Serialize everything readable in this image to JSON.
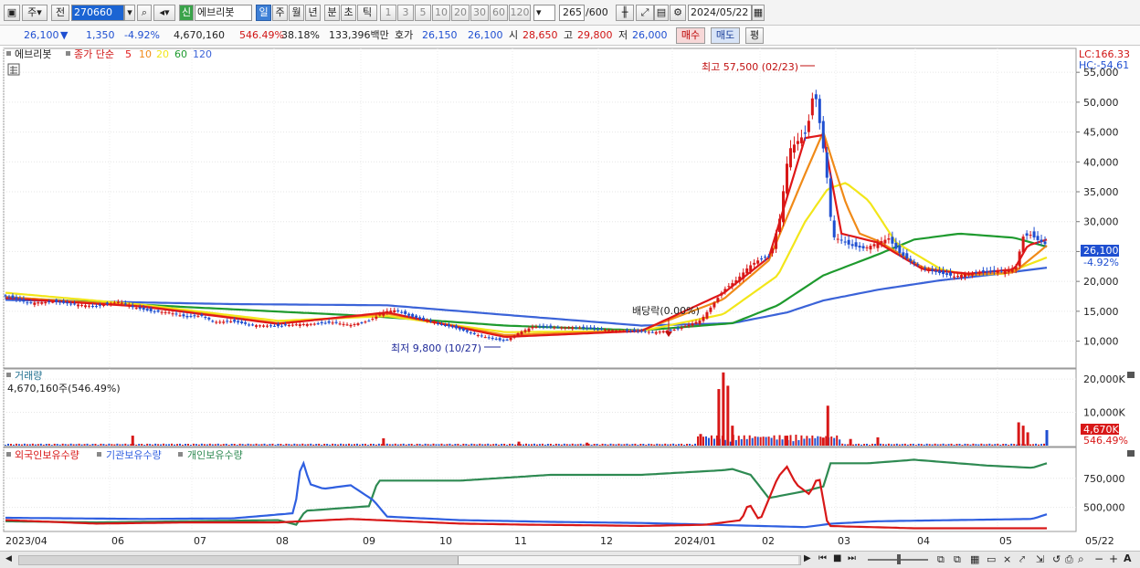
{
  "toolbar": {
    "mode": "주",
    "prev": "전",
    "code": "270660",
    "sin": "신",
    "name": "에브리봇",
    "periods": [
      "일",
      "주",
      "월",
      "년",
      "분",
      "초",
      "틱"
    ],
    "intervals": [
      "1",
      "3",
      "5",
      "10",
      "20",
      "30",
      "60",
      "120"
    ],
    "count": "265",
    "count_total": "/600",
    "date": "2024/05/22"
  },
  "quote": {
    "price": "26,100",
    "change": "1,350",
    "change_pct": "-4.92%",
    "volume": "4,670,160",
    "vol_ratio": "546.49%",
    "turnover": "38.18%",
    "amount": "133,396백만",
    "hoga_label": "호가",
    "ask": "26,150",
    "bid": "26,100",
    "open_label": "시",
    "open": "28,650",
    "high_label": "고",
    "high": "29,800",
    "low_label": "저",
    "low": "26,000",
    "buy": "매수",
    "sell": "매도",
    "pyeong": "평"
  },
  "price_panel": {
    "stock": "에브리봇",
    "legend_prefix": "종가 단순",
    "ma_periods": [
      "5",
      "10",
      "20",
      "60",
      "120"
    ],
    "ma_colors": [
      "#e01818",
      "#f08a18",
      "#f2e61a",
      "#1e9a2e",
      "#3b63d8"
    ],
    "lc": "LC:166.33",
    "hc": "HC:-54.61",
    "high_annotation": "최고 57,500 (02/23)",
    "low_annotation": "최저 9,800 (10/27)",
    "dividend_annotation": "배당락(0.00%)",
    "last_price": "26,100",
    "last_pct": "-4.92%"
  },
  "volume_panel": {
    "title": "거래량",
    "info": "4,670,160주(546.49%)",
    "last_label": "4,670K",
    "last_pct": "546.49%"
  },
  "holding_panel": {
    "legend": [
      "외국인보유수량",
      "기관보유수량",
      "개인보유수량"
    ],
    "colors": [
      "#d81818",
      "#2f5fe0",
      "#2e8a52"
    ]
  },
  "date_axis": [
    "2023/04",
    "06",
    "07",
    "08",
    "09",
    "10",
    "11",
    "12",
    "2024/01",
    "02",
    "03",
    "04",
    "05",
    "05/22"
  ],
  "chart_data": {
    "type": "candlestick",
    "price_axis": {
      "ticks": [
        10000,
        15000,
        20000,
        25000,
        30000,
        35000,
        40000,
        45000,
        50000,
        55000
      ],
      "labels": [
        "10,000",
        "15,000",
        "20,000",
        "25,000",
        "30,000",
        "35,000",
        "40,000",
        "45,000",
        "50,000",
        "55,000"
      ],
      "range": [
        5500,
        59000
      ]
    },
    "volume_axis": {
      "ticks": [
        10000,
        20000
      ],
      "labels": [
        "10,000K",
        "20,000K"
      ],
      "range": [
        0,
        22500
      ]
    },
    "holding_axis": {
      "ticks": [
        500000,
        750000
      ],
      "labels": [
        "500,000",
        "750,000"
      ],
      "range": [
        300000,
        1000000
      ]
    },
    "close_trend": [
      [
        0,
        17500
      ],
      [
        25,
        16400
      ],
      [
        50,
        16600
      ],
      [
        75,
        16200
      ],
      [
        100,
        15800
      ],
      [
        125,
        16600
      ],
      [
        140,
        15700
      ],
      [
        160,
        15000
      ],
      [
        180,
        14800
      ],
      [
        200,
        14000
      ],
      [
        215,
        14300
      ],
      [
        230,
        13200
      ],
      [
        250,
        13300
      ],
      [
        270,
        12700
      ],
      [
        300,
        12500
      ],
      [
        320,
        12800
      ],
      [
        340,
        12900
      ],
      [
        360,
        13100
      ],
      [
        380,
        12700
      ],
      [
        400,
        13400
      ],
      [
        418,
        15000
      ],
      [
        430,
        15200
      ],
      [
        445,
        14200
      ],
      [
        470,
        13200
      ],
      [
        495,
        12200
      ],
      [
        515,
        11200
      ],
      [
        535,
        10400
      ],
      [
        550,
        10000
      ],
      [
        565,
        11400
      ],
      [
        580,
        12400
      ],
      [
        600,
        12300
      ],
      [
        625,
        12300
      ],
      [
        650,
        12000
      ],
      [
        680,
        11700
      ],
      [
        715,
        11500
      ],
      [
        740,
        12000
      ],
      [
        765,
        13500
      ],
      [
        778,
        16000
      ],
      [
        790,
        18500
      ],
      [
        805,
        20300
      ],
      [
        818,
        22500
      ],
      [
        830,
        23700
      ],
      [
        842,
        24300
      ],
      [
        852,
        30500
      ],
      [
        862,
        42000
      ],
      [
        872,
        43500
      ],
      [
        882,
        45000
      ],
      [
        890,
        52500
      ],
      [
        897,
        45500
      ],
      [
        903,
        39000
      ],
      [
        910,
        27500
      ],
      [
        918,
        27000
      ],
      [
        930,
        26000
      ],
      [
        945,
        25500
      ],
      [
        960,
        26500
      ],
      [
        972,
        27200
      ],
      [
        982,
        25000
      ],
      [
        995,
        23500
      ],
      [
        1010,
        22200
      ],
      [
        1030,
        21300
      ],
      [
        1045,
        20800
      ],
      [
        1060,
        21400
      ],
      [
        1080,
        21500
      ],
      [
        1100,
        21700
      ],
      [
        1112,
        22500
      ],
      [
        1120,
        27500
      ],
      [
        1128,
        27800
      ],
      [
        1137,
        26800
      ],
      [
        1146,
        26100
      ]
    ],
    "moving_averages": {
      "5": [
        [
          0,
          17200
        ],
        [
          150,
          15800
        ],
        [
          300,
          12900
        ],
        [
          420,
          14800
        ],
        [
          550,
          10700
        ],
        [
          700,
          11700
        ],
        [
          790,
          18000
        ],
        [
          840,
          24000
        ],
        [
          880,
          44000
        ],
        [
          900,
          44500
        ],
        [
          920,
          28000
        ],
        [
          960,
          26500
        ],
        [
          1010,
          22000
        ],
        [
          1060,
          21300
        ],
        [
          1110,
          22000
        ],
        [
          1125,
          26000
        ],
        [
          1146,
          27000
        ]
      ],
      "10": [
        [
          0,
          17400
        ],
        [
          150,
          15900
        ],
        [
          300,
          13000
        ],
        [
          420,
          14600
        ],
        [
          550,
          11000
        ],
        [
          700,
          11800
        ],
        [
          790,
          17000
        ],
        [
          840,
          23500
        ],
        [
          880,
          38000
        ],
        [
          900,
          45000
        ],
        [
          925,
          33000
        ],
        [
          940,
          28000
        ],
        [
          960,
          26800
        ],
        [
          1010,
          22300
        ],
        [
          1060,
          21100
        ],
        [
          1110,
          21500
        ],
        [
          1146,
          26000
        ]
      ],
      "20": [
        [
          0,
          18100
        ],
        [
          150,
          16100
        ],
        [
          300,
          13400
        ],
        [
          420,
          14200
        ],
        [
          550,
          11500
        ],
        [
          700,
          11700
        ],
        [
          790,
          14500
        ],
        [
          850,
          21000
        ],
        [
          880,
          30000
        ],
        [
          905,
          35500
        ],
        [
          925,
          36500
        ],
        [
          950,
          33500
        ],
        [
          980,
          26500
        ],
        [
          1030,
          22000
        ],
        [
          1060,
          21100
        ],
        [
          1100,
          21300
        ],
        [
          1146,
          24000
        ]
      ],
      "60": [
        [
          0,
          17300
        ],
        [
          200,
          15700
        ],
        [
          400,
          14200
        ],
        [
          550,
          12600
        ],
        [
          700,
          11800
        ],
        [
          800,
          13000
        ],
        [
          850,
          16000
        ],
        [
          900,
          21000
        ],
        [
          960,
          24500
        ],
        [
          1000,
          27000
        ],
        [
          1050,
          28000
        ],
        [
          1110,
          27300
        ],
        [
          1146,
          25800
        ]
      ],
      "120": [
        [
          0,
          16900
        ],
        [
          250,
          16200
        ],
        [
          420,
          16000
        ],
        [
          550,
          14400
        ],
        [
          700,
          12600
        ],
        [
          800,
          13000
        ],
        [
          860,
          14800
        ],
        [
          900,
          16800
        ],
        [
          960,
          18600
        ],
        [
          1030,
          20200
        ],
        [
          1090,
          21200
        ],
        [
          1146,
          22300
        ]
      ]
    },
    "volume_spikes": [
      [
        140,
        3000
      ],
      [
        416,
        2200
      ],
      [
        565,
        1200
      ],
      [
        640,
        900
      ],
      [
        765,
        3500
      ],
      [
        785,
        17000
      ],
      [
        790,
        22000
      ],
      [
        795,
        18000
      ],
      [
        800,
        6000
      ],
      [
        860,
        3000
      ],
      [
        900,
        2400
      ],
      [
        905,
        12000
      ],
      [
        930,
        2000
      ],
      [
        960,
        2500
      ],
      [
        1115,
        7000
      ],
      [
        1120,
        6000
      ],
      [
        1125,
        4000
      ],
      [
        1146,
        4670
      ]
    ],
    "holding_series": {
      "외국인보유수량": [
        [
          0,
          390000
        ],
        [
          100,
          360000
        ],
        [
          200,
          370000
        ],
        [
          300,
          370000
        ],
        [
          380,
          400000
        ],
        [
          440,
          380000
        ],
        [
          500,
          360000
        ],
        [
          580,
          350000
        ],
        [
          650,
          345000
        ],
        [
          700,
          340000
        ],
        [
          770,
          350000
        ],
        [
          810,
          390000
        ],
        [
          818,
          540000
        ],
        [
          830,
          380000
        ],
        [
          850,
          760000
        ],
        [
          860,
          850000
        ],
        [
          870,
          700000
        ],
        [
          885,
          610000
        ],
        [
          895,
          780000
        ],
        [
          905,
          340000
        ],
        [
          950,
          330000
        ],
        [
          1000,
          320000
        ],
        [
          1146,
          320000
        ]
      ],
      "기관보유수량": [
        [
          0,
          410000
        ],
        [
          150,
          400000
        ],
        [
          250,
          405000
        ],
        [
          318,
          450000
        ],
        [
          326,
          930000
        ],
        [
          335,
          700000
        ],
        [
          350,
          660000
        ],
        [
          380,
          690000
        ],
        [
          405,
          560000
        ],
        [
          420,
          420000
        ],
        [
          500,
          390000
        ],
        [
          600,
          375000
        ],
        [
          700,
          365000
        ],
        [
          830,
          340000
        ],
        [
          880,
          330000
        ],
        [
          910,
          360000
        ],
        [
          960,
          380000
        ],
        [
          1000,
          385000
        ],
        [
          1130,
          400000
        ],
        [
          1146,
          440000
        ]
      ],
      "개인보유수량": [
        [
          0,
          380000
        ],
        [
          100,
          370000
        ],
        [
          200,
          380000
        ],
        [
          300,
          390000
        ],
        [
          320,
          350000
        ],
        [
          330,
          470000
        ],
        [
          400,
          510000
        ],
        [
          410,
          730000
        ],
        [
          500,
          730000
        ],
        [
          600,
          780000
        ],
        [
          700,
          780000
        ],
        [
          790,
          820000
        ],
        [
          800,
          830000
        ],
        [
          820,
          780000
        ],
        [
          840,
          580000
        ],
        [
          860,
          610000
        ],
        [
          880,
          640000
        ],
        [
          900,
          680000
        ],
        [
          908,
          880000
        ],
        [
          950,
          880000
        ],
        [
          1000,
          910000
        ],
        [
          1080,
          860000
        ],
        [
          1130,
          840000
        ],
        [
          1146,
          880000
        ]
      ]
    }
  }
}
